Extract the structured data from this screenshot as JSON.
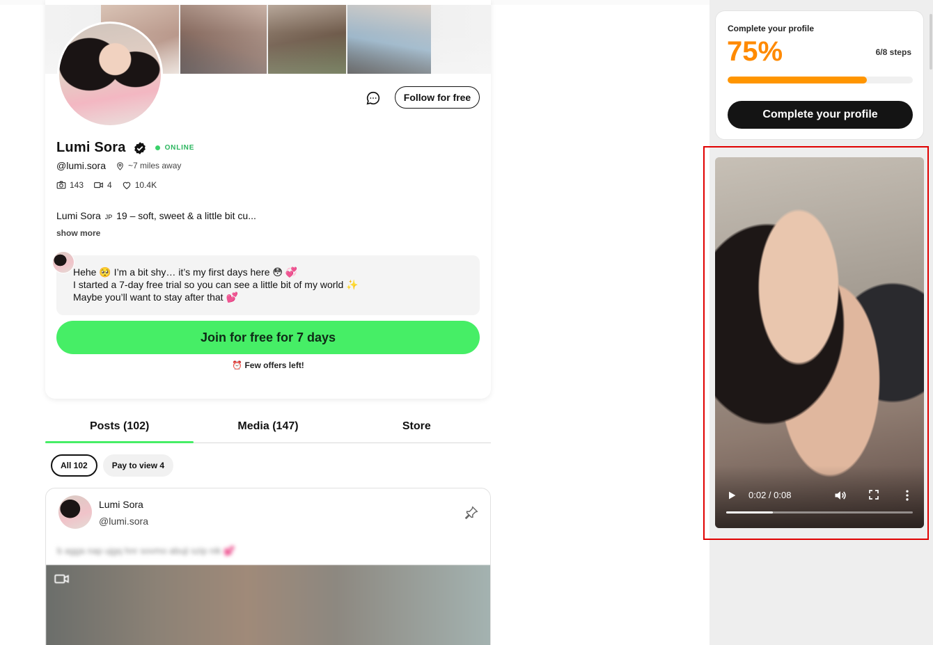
{
  "profile": {
    "name": "Lumi Sora",
    "status": "ONLINE",
    "handle": "@lumi.sora",
    "distance": "~7 miles away",
    "stats": {
      "photos": "143",
      "videos": "4",
      "likes": "10.4K"
    },
    "bio_start": "Lumi Sora",
    "bio_flag": "JP",
    "bio_rest": "19 – soft, sweet & a little bit cu...",
    "show_more": "show more",
    "follow_label": "Follow for free",
    "message": {
      "line1": "Hehe 🥺 I’m a bit shy… it’s my first days here 😳 💞",
      "line2": "I started a 7-day free trial so you can see a little bit of my world ✨",
      "line3": "Maybe you’ll want to stay after that 💕"
    },
    "join_label": "Join for free for 7 days",
    "offers_note": "⏰ Few offers left!"
  },
  "tabs": [
    {
      "label": "Posts (102)",
      "active": true
    },
    {
      "label": "Media (147)",
      "active": false
    },
    {
      "label": "Store",
      "active": false
    }
  ],
  "filters": [
    {
      "label": "All 102",
      "active": true
    },
    {
      "label": "Pay to view 4",
      "active": false
    }
  ],
  "post": {
    "author": "Lumi Sora",
    "handle": "@lumi.sora",
    "blurred_text": "b agga nap ujgq hnr sovmo abuji szip nik 💕"
  },
  "completion": {
    "title": "Complete your profile",
    "percent_label": "75%",
    "percent": 0.75,
    "steps": "6/8 steps",
    "button": "Complete your profile",
    "accent": "#ff8a00"
  },
  "video": {
    "time": "0:02 / 0:08",
    "progress": 0.25
  },
  "colors": {
    "join_green": "#46ee66",
    "online_green": "#2bb55e",
    "highlight_red": "#e00000"
  }
}
